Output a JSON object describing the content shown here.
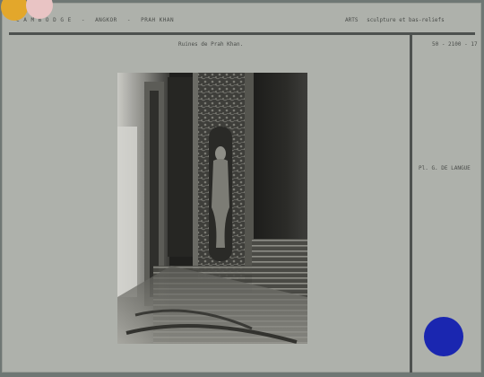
{
  "header": {
    "country": "C A M B O D G E",
    "site": "ANGKOR",
    "monument": "PRAH KHAN",
    "category_code": "ARTS",
    "category": "sculpture et bas-reliefs"
  },
  "caption": "Ruines de Prah Khan.",
  "reference": "50 - 2100 - 17",
  "credit": "Pl. G. DE LANGUE",
  "colors": {
    "background": "#6f7774",
    "card": "#aeb1ab",
    "rule": "#4d514f",
    "sticker_yellow": "#e3a72b",
    "sticker_pink": "#e9c4c4",
    "sticker_blue": "#1a26b0"
  }
}
